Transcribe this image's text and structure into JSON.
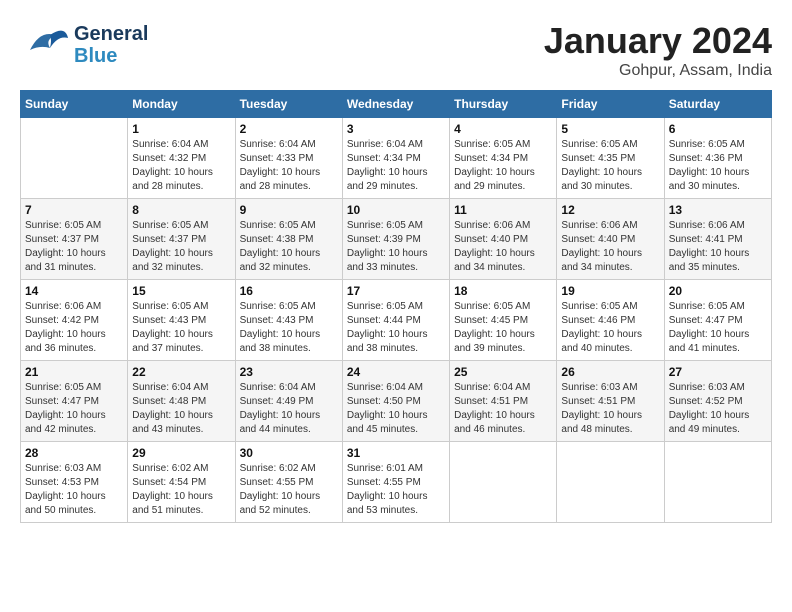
{
  "header": {
    "logo_line1": "General",
    "logo_line2": "Blue",
    "month": "January 2024",
    "location": "Gohpur, Assam, India"
  },
  "weekdays": [
    "Sunday",
    "Monday",
    "Tuesday",
    "Wednesday",
    "Thursday",
    "Friday",
    "Saturday"
  ],
  "weeks": [
    [
      {
        "day": "",
        "sunrise": "",
        "sunset": "",
        "daylight": ""
      },
      {
        "day": "1",
        "sunrise": "Sunrise: 6:04 AM",
        "sunset": "Sunset: 4:32 PM",
        "daylight": "Daylight: 10 hours and 28 minutes."
      },
      {
        "day": "2",
        "sunrise": "Sunrise: 6:04 AM",
        "sunset": "Sunset: 4:33 PM",
        "daylight": "Daylight: 10 hours and 28 minutes."
      },
      {
        "day": "3",
        "sunrise": "Sunrise: 6:04 AM",
        "sunset": "Sunset: 4:34 PM",
        "daylight": "Daylight: 10 hours and 29 minutes."
      },
      {
        "day": "4",
        "sunrise": "Sunrise: 6:05 AM",
        "sunset": "Sunset: 4:34 PM",
        "daylight": "Daylight: 10 hours and 29 minutes."
      },
      {
        "day": "5",
        "sunrise": "Sunrise: 6:05 AM",
        "sunset": "Sunset: 4:35 PM",
        "daylight": "Daylight: 10 hours and 30 minutes."
      },
      {
        "day": "6",
        "sunrise": "Sunrise: 6:05 AM",
        "sunset": "Sunset: 4:36 PM",
        "daylight": "Daylight: 10 hours and 30 minutes."
      }
    ],
    [
      {
        "day": "7",
        "sunrise": "Sunrise: 6:05 AM",
        "sunset": "Sunset: 4:37 PM",
        "daylight": "Daylight: 10 hours and 31 minutes."
      },
      {
        "day": "8",
        "sunrise": "Sunrise: 6:05 AM",
        "sunset": "Sunset: 4:37 PM",
        "daylight": "Daylight: 10 hours and 32 minutes."
      },
      {
        "day": "9",
        "sunrise": "Sunrise: 6:05 AM",
        "sunset": "Sunset: 4:38 PM",
        "daylight": "Daylight: 10 hours and 32 minutes."
      },
      {
        "day": "10",
        "sunrise": "Sunrise: 6:05 AM",
        "sunset": "Sunset: 4:39 PM",
        "daylight": "Daylight: 10 hours and 33 minutes."
      },
      {
        "day": "11",
        "sunrise": "Sunrise: 6:06 AM",
        "sunset": "Sunset: 4:40 PM",
        "daylight": "Daylight: 10 hours and 34 minutes."
      },
      {
        "day": "12",
        "sunrise": "Sunrise: 6:06 AM",
        "sunset": "Sunset: 4:40 PM",
        "daylight": "Daylight: 10 hours and 34 minutes."
      },
      {
        "day": "13",
        "sunrise": "Sunrise: 6:06 AM",
        "sunset": "Sunset: 4:41 PM",
        "daylight": "Daylight: 10 hours and 35 minutes."
      }
    ],
    [
      {
        "day": "14",
        "sunrise": "Sunrise: 6:06 AM",
        "sunset": "Sunset: 4:42 PM",
        "daylight": "Daylight: 10 hours and 36 minutes."
      },
      {
        "day": "15",
        "sunrise": "Sunrise: 6:05 AM",
        "sunset": "Sunset: 4:43 PM",
        "daylight": "Daylight: 10 hours and 37 minutes."
      },
      {
        "day": "16",
        "sunrise": "Sunrise: 6:05 AM",
        "sunset": "Sunset: 4:43 PM",
        "daylight": "Daylight: 10 hours and 38 minutes."
      },
      {
        "day": "17",
        "sunrise": "Sunrise: 6:05 AM",
        "sunset": "Sunset: 4:44 PM",
        "daylight": "Daylight: 10 hours and 38 minutes."
      },
      {
        "day": "18",
        "sunrise": "Sunrise: 6:05 AM",
        "sunset": "Sunset: 4:45 PM",
        "daylight": "Daylight: 10 hours and 39 minutes."
      },
      {
        "day": "19",
        "sunrise": "Sunrise: 6:05 AM",
        "sunset": "Sunset: 4:46 PM",
        "daylight": "Daylight: 10 hours and 40 minutes."
      },
      {
        "day": "20",
        "sunrise": "Sunrise: 6:05 AM",
        "sunset": "Sunset: 4:47 PM",
        "daylight": "Daylight: 10 hours and 41 minutes."
      }
    ],
    [
      {
        "day": "21",
        "sunrise": "Sunrise: 6:05 AM",
        "sunset": "Sunset: 4:47 PM",
        "daylight": "Daylight: 10 hours and 42 minutes."
      },
      {
        "day": "22",
        "sunrise": "Sunrise: 6:04 AM",
        "sunset": "Sunset: 4:48 PM",
        "daylight": "Daylight: 10 hours and 43 minutes."
      },
      {
        "day": "23",
        "sunrise": "Sunrise: 6:04 AM",
        "sunset": "Sunset: 4:49 PM",
        "daylight": "Daylight: 10 hours and 44 minutes."
      },
      {
        "day": "24",
        "sunrise": "Sunrise: 6:04 AM",
        "sunset": "Sunset: 4:50 PM",
        "daylight": "Daylight: 10 hours and 45 minutes."
      },
      {
        "day": "25",
        "sunrise": "Sunrise: 6:04 AM",
        "sunset": "Sunset: 4:51 PM",
        "daylight": "Daylight: 10 hours and 46 minutes."
      },
      {
        "day": "26",
        "sunrise": "Sunrise: 6:03 AM",
        "sunset": "Sunset: 4:51 PM",
        "daylight": "Daylight: 10 hours and 48 minutes."
      },
      {
        "day": "27",
        "sunrise": "Sunrise: 6:03 AM",
        "sunset": "Sunset: 4:52 PM",
        "daylight": "Daylight: 10 hours and 49 minutes."
      }
    ],
    [
      {
        "day": "28",
        "sunrise": "Sunrise: 6:03 AM",
        "sunset": "Sunset: 4:53 PM",
        "daylight": "Daylight: 10 hours and 50 minutes."
      },
      {
        "day": "29",
        "sunrise": "Sunrise: 6:02 AM",
        "sunset": "Sunset: 4:54 PM",
        "daylight": "Daylight: 10 hours and 51 minutes."
      },
      {
        "day": "30",
        "sunrise": "Sunrise: 6:02 AM",
        "sunset": "Sunset: 4:55 PM",
        "daylight": "Daylight: 10 hours and 52 minutes."
      },
      {
        "day": "31",
        "sunrise": "Sunrise: 6:01 AM",
        "sunset": "Sunset: 4:55 PM",
        "daylight": "Daylight: 10 hours and 53 minutes."
      },
      {
        "day": "",
        "sunrise": "",
        "sunset": "",
        "daylight": ""
      },
      {
        "day": "",
        "sunrise": "",
        "sunset": "",
        "daylight": ""
      },
      {
        "day": "",
        "sunrise": "",
        "sunset": "",
        "daylight": ""
      }
    ]
  ]
}
